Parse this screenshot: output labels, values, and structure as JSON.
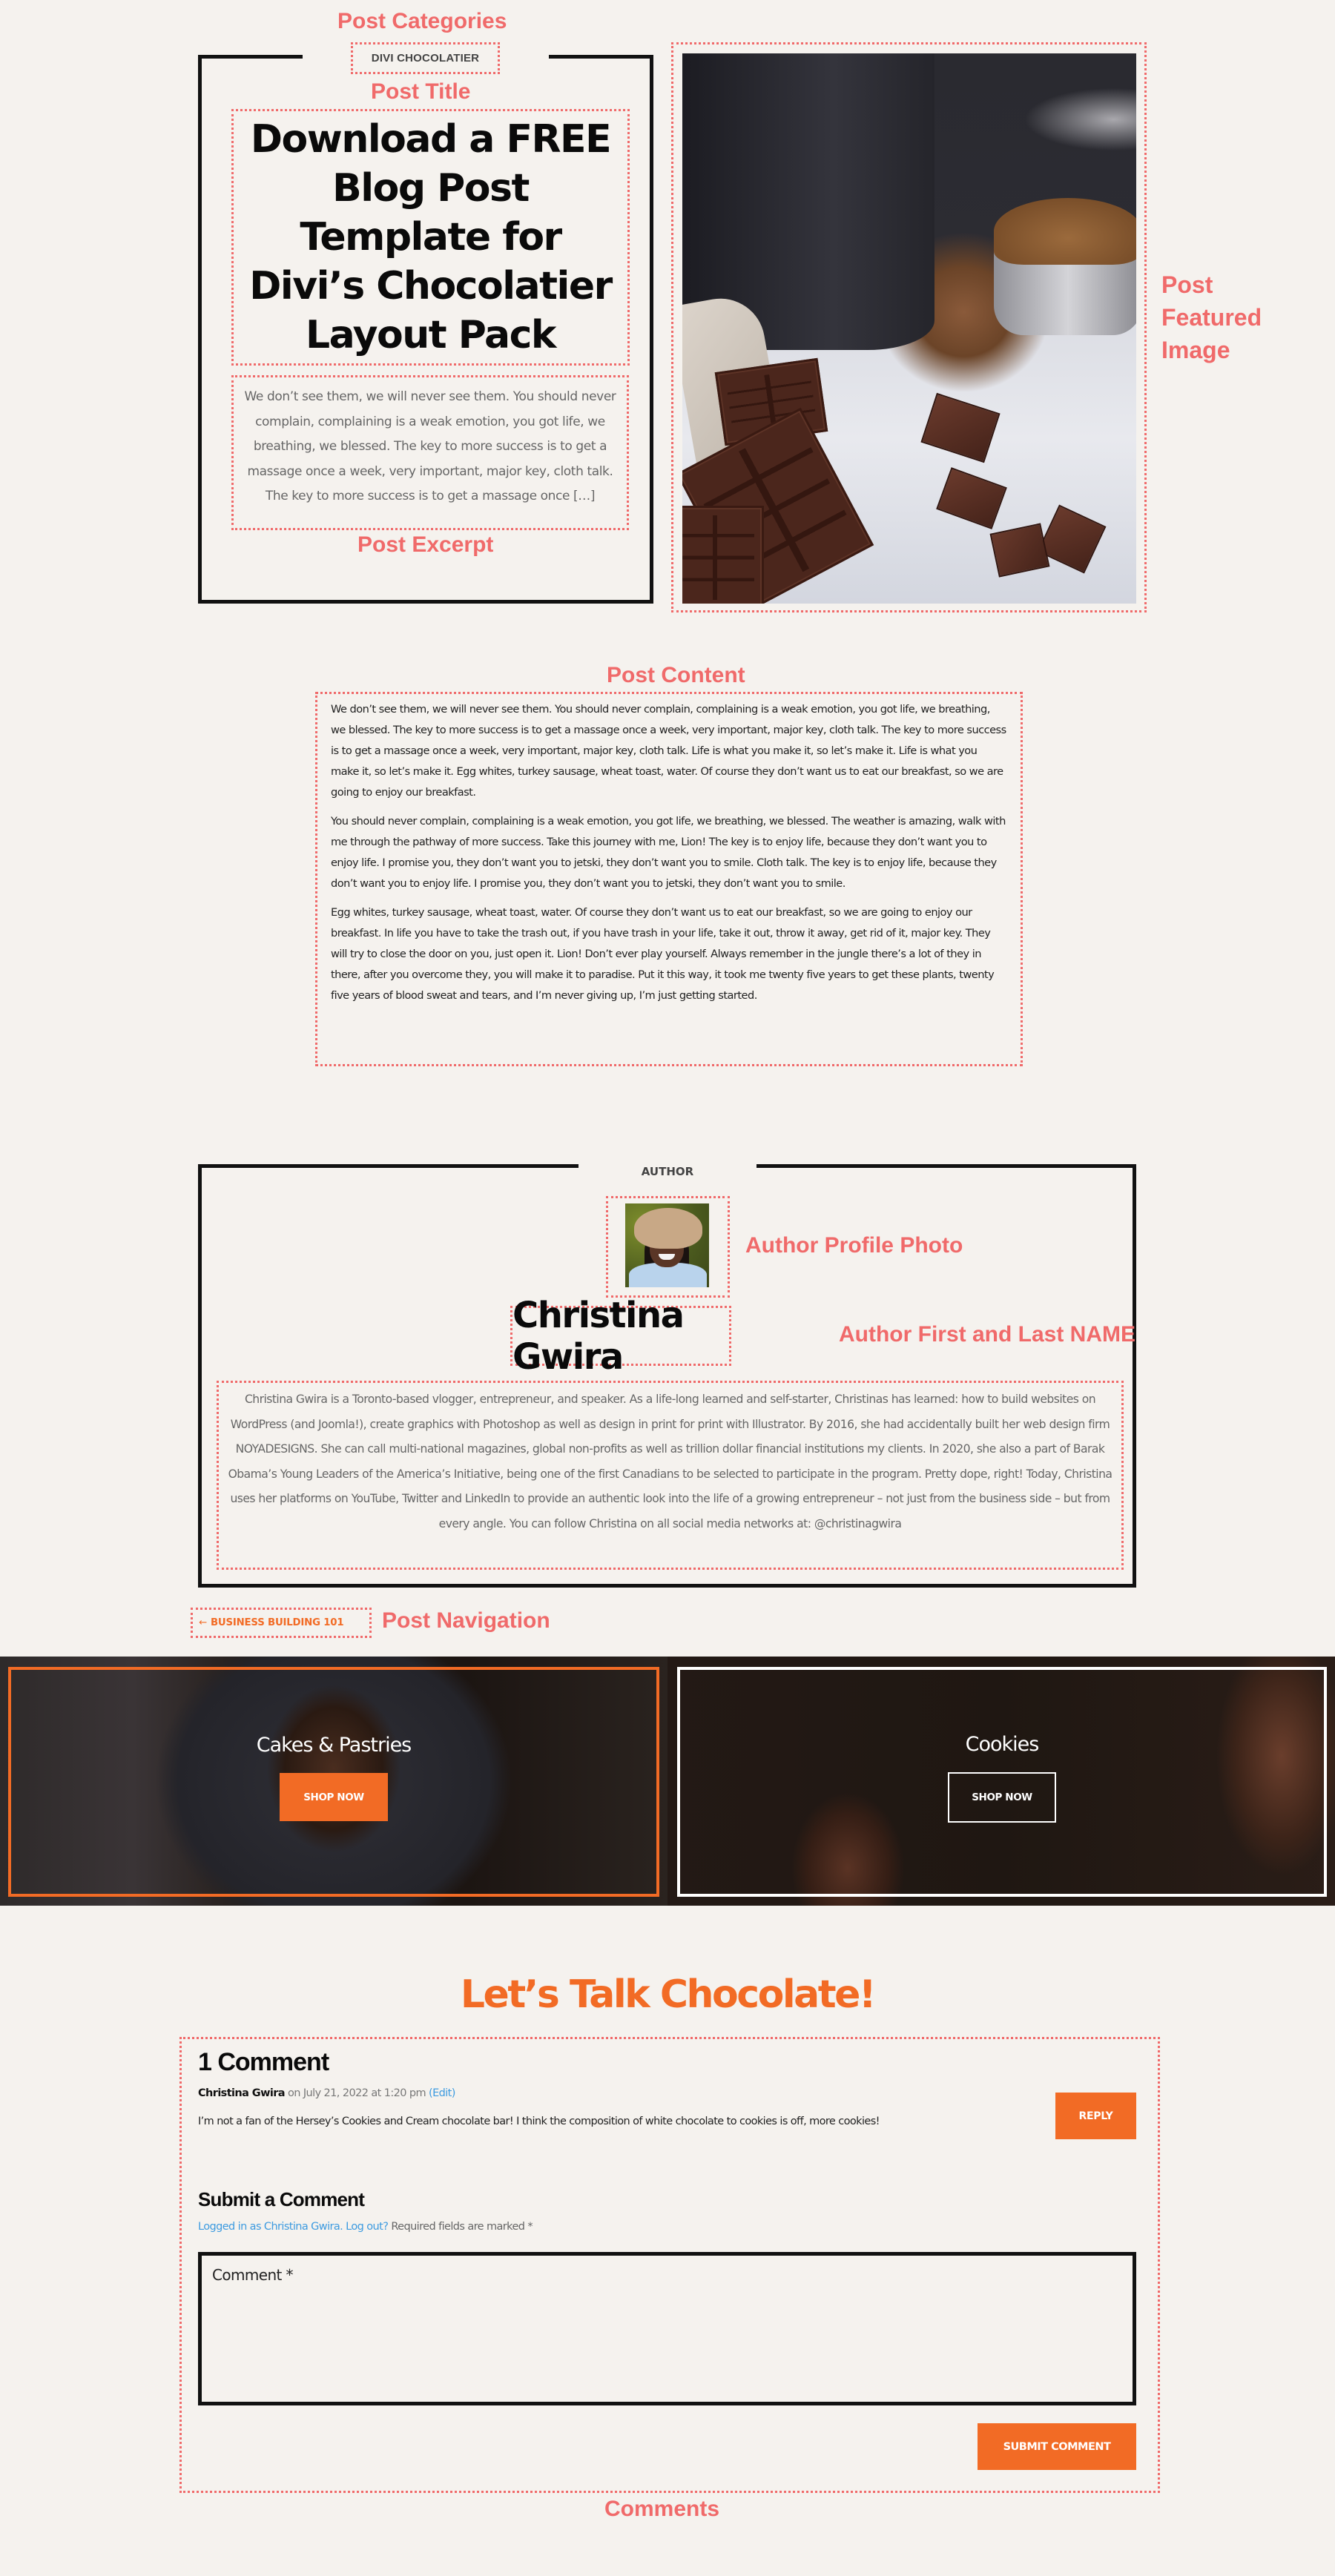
{
  "annotations": {
    "post_categories": "Post Categories",
    "post_title": "Post Title",
    "post_excerpt": "Post Excerpt",
    "post_featured_image": [
      "Post",
      "Featured",
      "Image"
    ],
    "post_content": "Post Content",
    "author_profile_photo": "Author Profile Photo",
    "author_name": "Author First and Last NAME",
    "post_navigation": "Post Navigation",
    "comments": "Comments"
  },
  "post": {
    "category": "DIVI CHOCOLATIER",
    "title": "Download a FREE Blog Post Template for Divi’s Chocolatier Layout Pack",
    "excerpt": "We don’t see them, we will never see them. You should never complain, complaining is a weak emotion, you got life, we breathing, we blessed. The key to more success is to get a massage once a week, very important, major key, cloth talk. The key to more success is to get a massage once […]",
    "featured_image_alt": "Chocolate bars and cocoa on a marble counter",
    "content": [
      "We don’t see them, we will never see them. You should never complain, complaining is a weak emotion, you got life, we breathing, we blessed. The key to more success is to get a massage once a week, very important, major key, cloth talk. The key to more success is to get a massage once a week, very important, major key, cloth talk. Life is what you make it, so let’s make it. Life is what you make it, so let’s make it. Egg whites, turkey sausage, wheat toast, water. Of course they don’t want us to eat our breakfast, so we are going to enjoy our breakfast.",
      "You should never complain, complaining is a weak emotion, you got life, we breathing, we blessed. The weather is amazing, walk with me through the pathway of more success. Take this journey with me, Lion! The key is to enjoy life, because they don’t want you to enjoy life. I promise you, they don’t want you to jetski, they don’t want you to smile. Cloth talk. The key is to enjoy life, because they don’t want you to enjoy life. I promise you, they don’t want you to jetski, they don’t want you to smile.",
      "Egg whites, turkey sausage, wheat toast, water. Of course they don’t want us to eat our breakfast, so we are going to enjoy our breakfast. In life you have to take the trash out, if you have trash in your life, take it out, throw it away, get rid of it, major key. They will try to close the door on you, just open it. Lion! Don’t ever play yourself. Always remember in the jungle there’s a lot of they in there, after you overcome they, you will make it to paradise. Put it this way, it took me twenty five years to get these plants, twenty five years of blood sweat and tears, and I’m never giving up, I’m just getting started."
    ]
  },
  "author": {
    "section_label": "AUTHOR",
    "name": "Christina Gwira",
    "bio": "Christina Gwira is a Toronto-based vlogger, entrepreneur, and speaker. As a life-long learned and self-starter, Christinas has learned: how to build websites on WordPress (and Joomla!), create graphics with Photoshop as well as design in print for print with Illustrator. By 2016, she had accidentally built her web design firm NOYADESIGNS. She can call multi-national magazines, global non-profits as well as trillion dollar financial institutions my clients. In 2020, she also a part of Barak Obama’s Young Leaders of the America’s Initiative, being one of the first Canadians to be selected to participate in the program. Pretty dope, right! Today, Christina uses her platforms on YouTube, Twitter and LinkedIn to provide an authentic look into the life of a growing entrepreneur – not just from the business side – but from every angle. You can follow Christina on all social media networks at: @christinagwira"
  },
  "navigation": {
    "prev_arrow": "←",
    "prev_label": "BUSINESS BUILDING 101"
  },
  "promo": [
    {
      "title": "Cakes & Pastries",
      "button": "SHOP NOW"
    },
    {
      "title": "Cookies",
      "button": "SHOP NOW"
    }
  ],
  "comments": {
    "heading": "Let’s Talk Chocolate!",
    "count_label": "1 Comment",
    "items": [
      {
        "author": "Christina Gwira",
        "date": "on July 21, 2022 at 1:20 pm",
        "edit_label": "(Edit)",
        "text": "I’m not a fan of the Hersey’s Cookies and Cream chocolate bar! I think the composition of white chocolate to cookies is off, more cookies!",
        "reply_label": "REPLY"
      }
    ],
    "form": {
      "title": "Submit a Comment",
      "logged_in_link": "Logged in as Christina Gwira.",
      "logout_link": "Log out?",
      "required_note": "Required fields are marked *",
      "comment_placeholder": "Comment *",
      "comment_value": "",
      "submit_label": "SUBMIT COMMENT"
    }
  },
  "colors": {
    "accent": "#f26b25",
    "annotation": "#f06a6a",
    "background": "#f5f2ee",
    "link": "#3d9be0"
  }
}
